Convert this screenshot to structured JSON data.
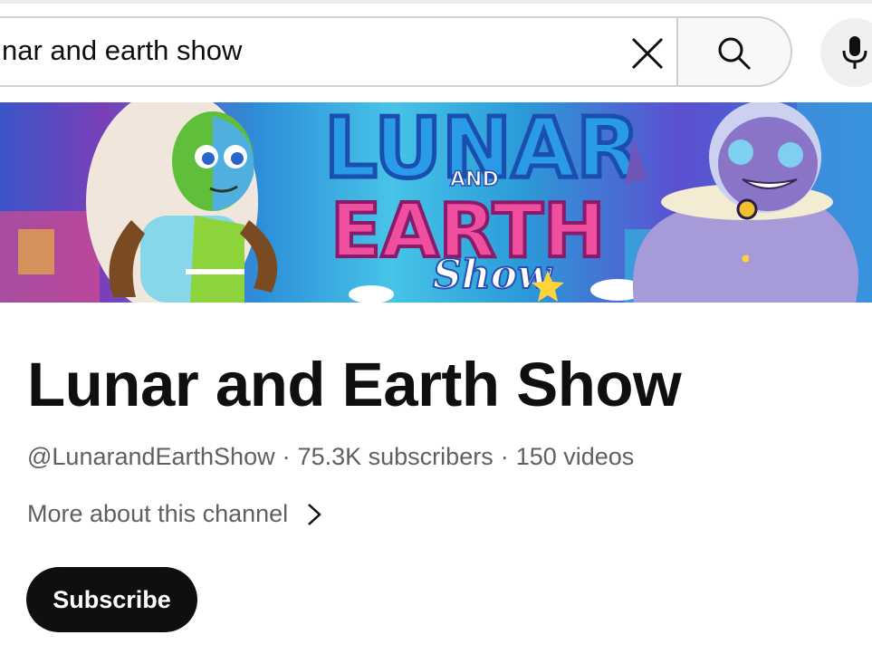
{
  "search": {
    "query": "nar and earth show"
  },
  "icons": {
    "clear": "close-icon",
    "search": "search-icon",
    "mic": "microphone-icon",
    "chevron": "chevron-right-icon"
  },
  "banner": {
    "title_top": "LUNAR",
    "title_and": "AND",
    "title_mid": "EARTH",
    "title_script": "Show"
  },
  "channel": {
    "name": "Lunar and Earth Show",
    "handle": "@LunarandEarthShow",
    "separator": "·",
    "subscribers": "75.3K subscribers",
    "videos": "150 videos",
    "more_about": "More about this channel",
    "subscribe_label": "Subscribe"
  },
  "colors": {
    "primary_text": "#0f0f0f",
    "secondary_text": "#606060",
    "subscribe_bg": "#0f0f0f",
    "subscribe_text": "#ffffff"
  }
}
